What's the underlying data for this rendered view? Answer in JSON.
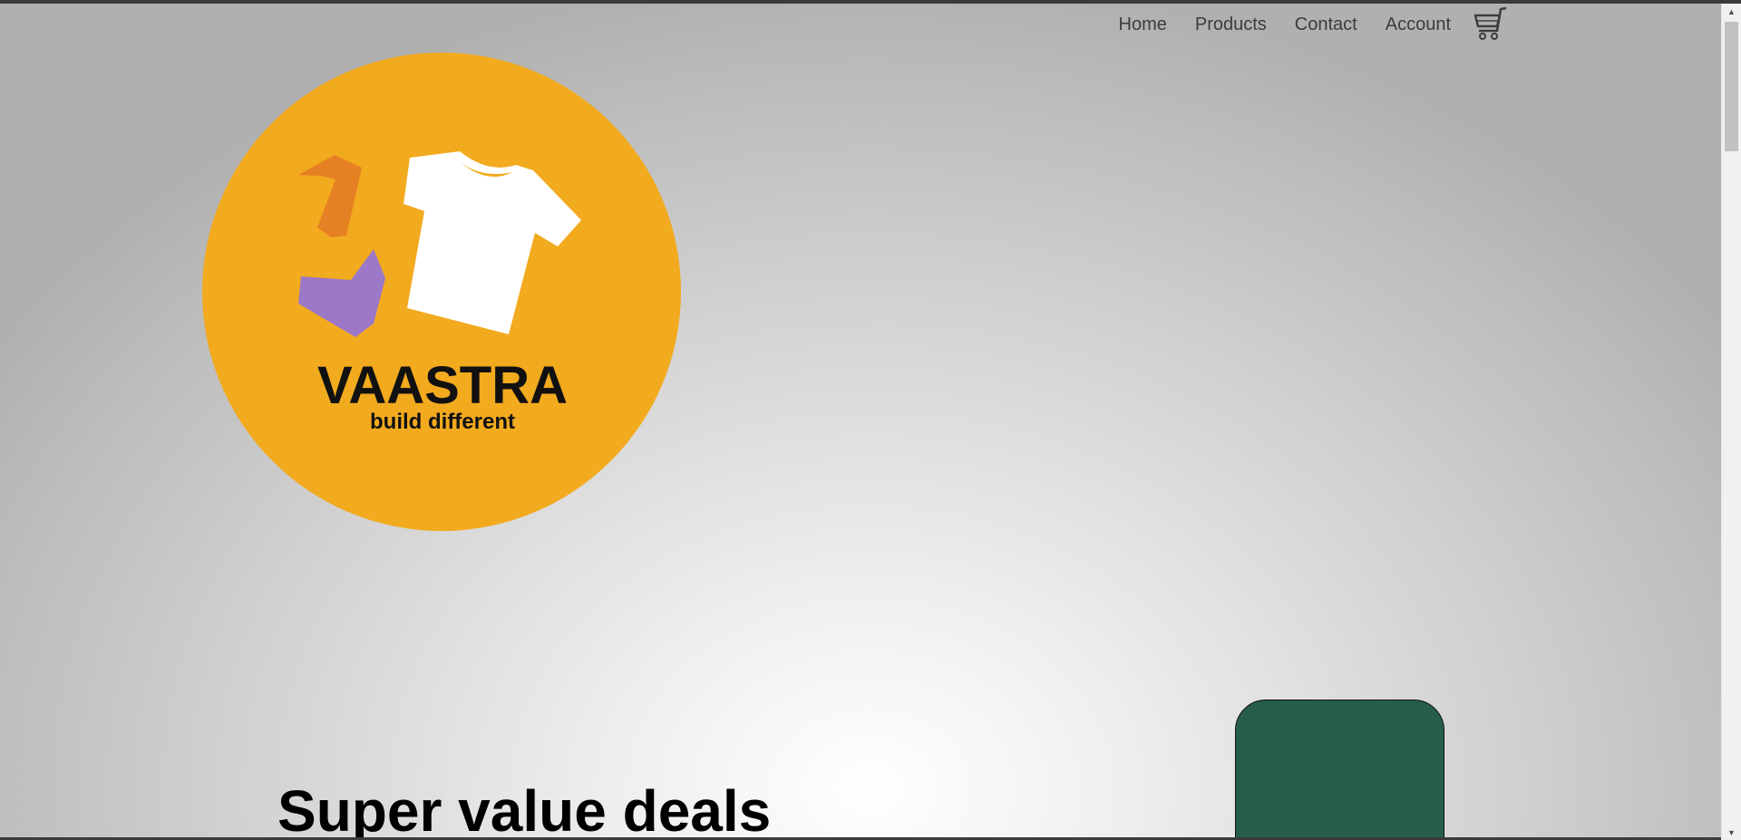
{
  "nav": {
    "items": [
      {
        "label": "Home"
      },
      {
        "label": "Products"
      },
      {
        "label": "Contact"
      },
      {
        "label": "Account"
      }
    ],
    "cart_icon": "shopping-cart-icon"
  },
  "logo": {
    "brand": "VAASTRA",
    "tagline": "build different",
    "icon": "t-shirt-icon",
    "colors": {
      "circle": "#f2aa1e",
      "orange": "#e68024",
      "purple": "#9b78c8",
      "shirt": "#ffffff"
    }
  },
  "hero": {
    "heading": "Super value deals"
  },
  "colors": {
    "card": "#265e49",
    "nav_text": "#3c3c3c"
  }
}
